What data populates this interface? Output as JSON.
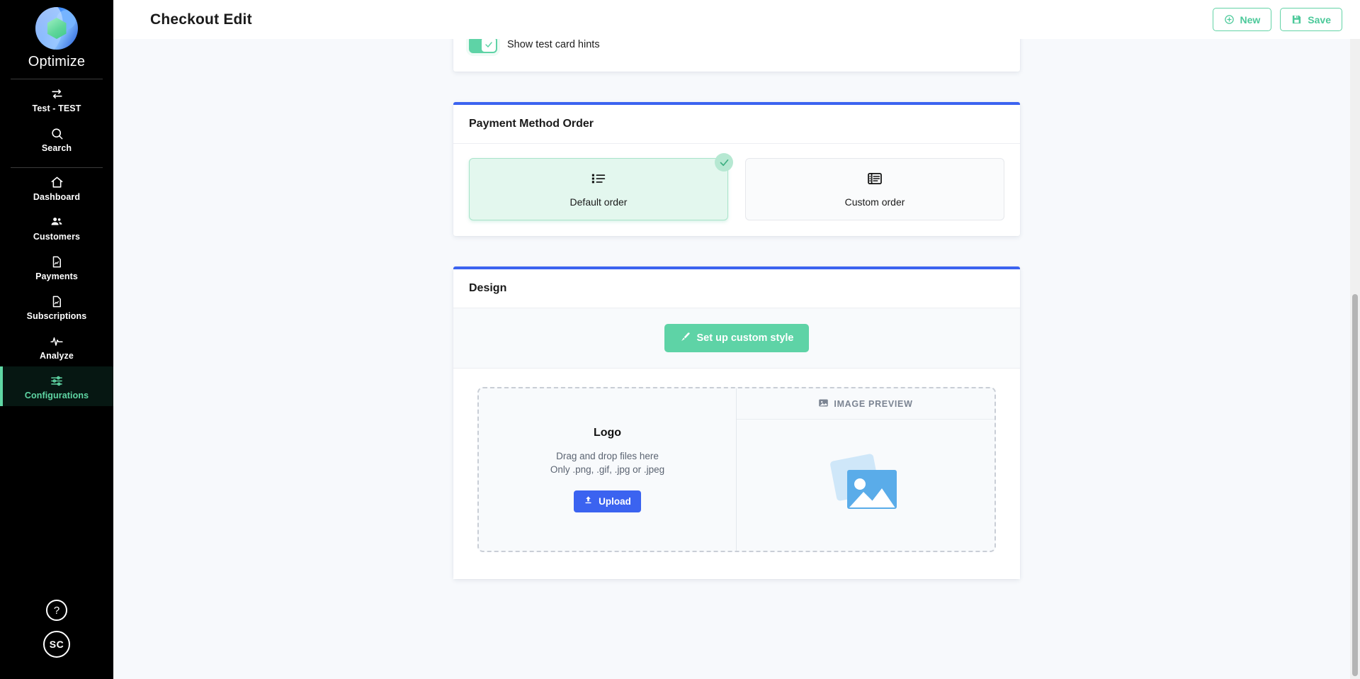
{
  "sidebar": {
    "brand": {
      "name": "Optimize",
      "logo_icon": "hexagon-sphere-logo"
    },
    "top_items": [
      {
        "label": "Test - TEST",
        "icon": "switch-arrows-icon"
      },
      {
        "label": "Search",
        "icon": "search-icon"
      }
    ],
    "nav_items": [
      {
        "label": "Dashboard",
        "icon": "home-icon",
        "active": false
      },
      {
        "label": "Customers",
        "icon": "users-icon",
        "active": false
      },
      {
        "label": "Payments",
        "icon": "document-chart-icon",
        "active": false
      },
      {
        "label": "Subscriptions",
        "icon": "document-chart-icon",
        "active": false
      },
      {
        "label": "Analyze",
        "icon": "pulse-icon",
        "active": false
      },
      {
        "label": "Configurations",
        "icon": "sliders-icon",
        "active": true
      }
    ],
    "help_label": "?",
    "avatar_label": "SC",
    "active_color": "#5fd6a4"
  },
  "header": {
    "title": "Checkout Edit",
    "new_label": "New",
    "save_label": "Save",
    "accent_color": "#4cc99a"
  },
  "test_card_section": {
    "toggle_label": "Show test card hints",
    "toggle_on": true,
    "toggle_color": "#5ed3a6"
  },
  "payment_method_order": {
    "title": "Payment Method Order",
    "accent_color": "#3b63f0",
    "options": [
      {
        "label": "Default order",
        "icon": "list-bullet-icon",
        "selected": true
      },
      {
        "label": "Custom order",
        "icon": "list-box-icon",
        "selected": false
      }
    ]
  },
  "design": {
    "title": "Design",
    "accent_color": "#3b63f0",
    "custom_style_button": {
      "label": "Set up custom style",
      "icon": "brush-icon",
      "color": "#5ed3a6"
    },
    "logo_drop": {
      "title": "Logo",
      "line1": "Drag and drop files here",
      "line2": "Only .png, .gif, .jpg or .jpeg",
      "upload_label": "Upload",
      "upload_icon": "upload-icon",
      "upload_color": "#3b63f0"
    },
    "image_preview": {
      "label": "IMAGE PREVIEW",
      "icon": "image-icon",
      "placeholder_icon": "image-placeholder-icon",
      "placeholder_color": "#5aace9"
    }
  }
}
